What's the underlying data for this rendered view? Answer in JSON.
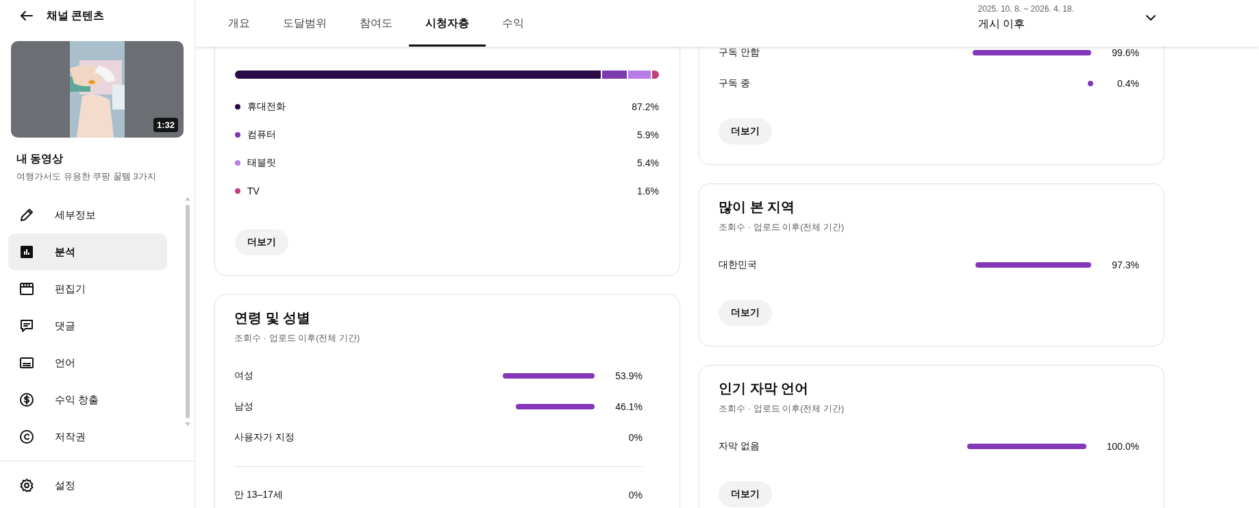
{
  "sidebar": {
    "title": "채널 콘텐츠",
    "video": {
      "duration": "1:32",
      "heading": "내 동영상",
      "title": "여행가서도 유용한 쿠팡 꿀템 3가지"
    },
    "items": [
      {
        "label": "세부정보",
        "selected": false
      },
      {
        "label": "분석",
        "selected": true
      },
      {
        "label": "편집기",
        "selected": false
      },
      {
        "label": "댓글",
        "selected": false
      },
      {
        "label": "언어",
        "selected": false
      },
      {
        "label": "수익 창출",
        "selected": false
      },
      {
        "label": "저작권",
        "selected": false
      }
    ],
    "footer_items": [
      {
        "label": "설정",
        "selected": false
      }
    ]
  },
  "tabs": [
    {
      "label": "개요",
      "selected": false
    },
    {
      "label": "도달범위",
      "selected": false
    },
    {
      "label": "참여도",
      "selected": false
    },
    {
      "label": "시청자층",
      "selected": true
    },
    {
      "label": "수익",
      "selected": false
    }
  ],
  "date_range": {
    "range": "2025. 10. 8. ~ 2026. 4. 18.",
    "label": "게시 이후"
  },
  "left_cards": [
    {
      "kind": "devices",
      "segments": [
        {
          "label": "휴대전화",
          "value": "87.2%",
          "color": "#2a0b45"
        },
        {
          "label": "컴퓨터",
          "value": "5.9%",
          "color": "#7b3aad"
        },
        {
          "label": "태블릿",
          "value": "5.4%",
          "color": "#b77ce8"
        },
        {
          "label": "TV",
          "value": "1.6%",
          "color": "#c0407e"
        }
      ],
      "more_button": "더보기"
    },
    {
      "kind": "bars",
      "title": "연령 및 성별",
      "subtitle": "조회수 · 업로드 이후(전체 기간)",
      "rows": [
        {
          "label": "여성",
          "value": "53.9%"
        },
        {
          "label": "남성",
          "value": "46.1%"
        },
        {
          "label": "사용자가 지정",
          "value": "0%"
        }
      ],
      "more_rows": [
        {
          "label": "만 13–17세",
          "value": "0%"
        }
      ]
    }
  ],
  "right_cards": [
    {
      "kind": "bars",
      "rows": [
        {
          "label": "구독 안함",
          "value": "99.6%"
        },
        {
          "label": "구독 중",
          "value": "0.4%"
        }
      ],
      "more_button": "더보기"
    },
    {
      "kind": "bars",
      "title": "많이 본 지역",
      "subtitle": "조회수 · 업로드 이후(전체 기간)",
      "rows": [
        {
          "label": "대한민국",
          "value": "97.3%"
        }
      ],
      "more_button": "더보기"
    },
    {
      "kind": "bars",
      "title": "인기 자막 언어",
      "subtitle": "조회수 · 업로드 이후(전체 기간)",
      "rows": [
        {
          "label": "자막 없음",
          "value": "100.0%"
        }
      ],
      "more_button": "더보기"
    }
  ]
}
